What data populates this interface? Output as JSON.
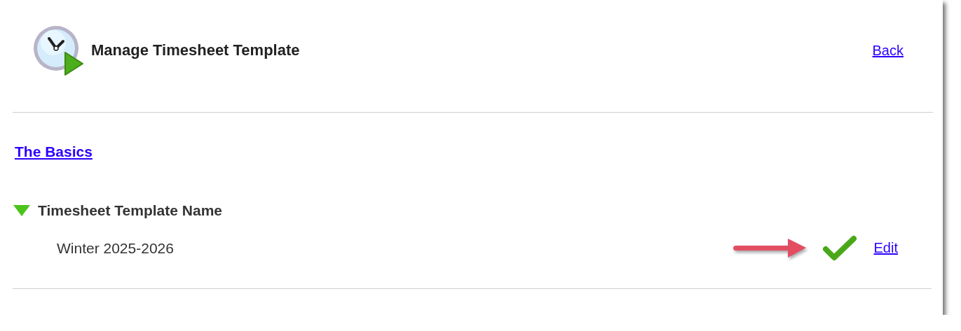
{
  "header": {
    "title": "Manage Timesheet Template",
    "back_link": "Back"
  },
  "section_link": "The Basics",
  "section": {
    "title": "Timesheet Template Name",
    "expanded": true,
    "value": "Winter 2025-2026",
    "edit_link": "Edit"
  }
}
